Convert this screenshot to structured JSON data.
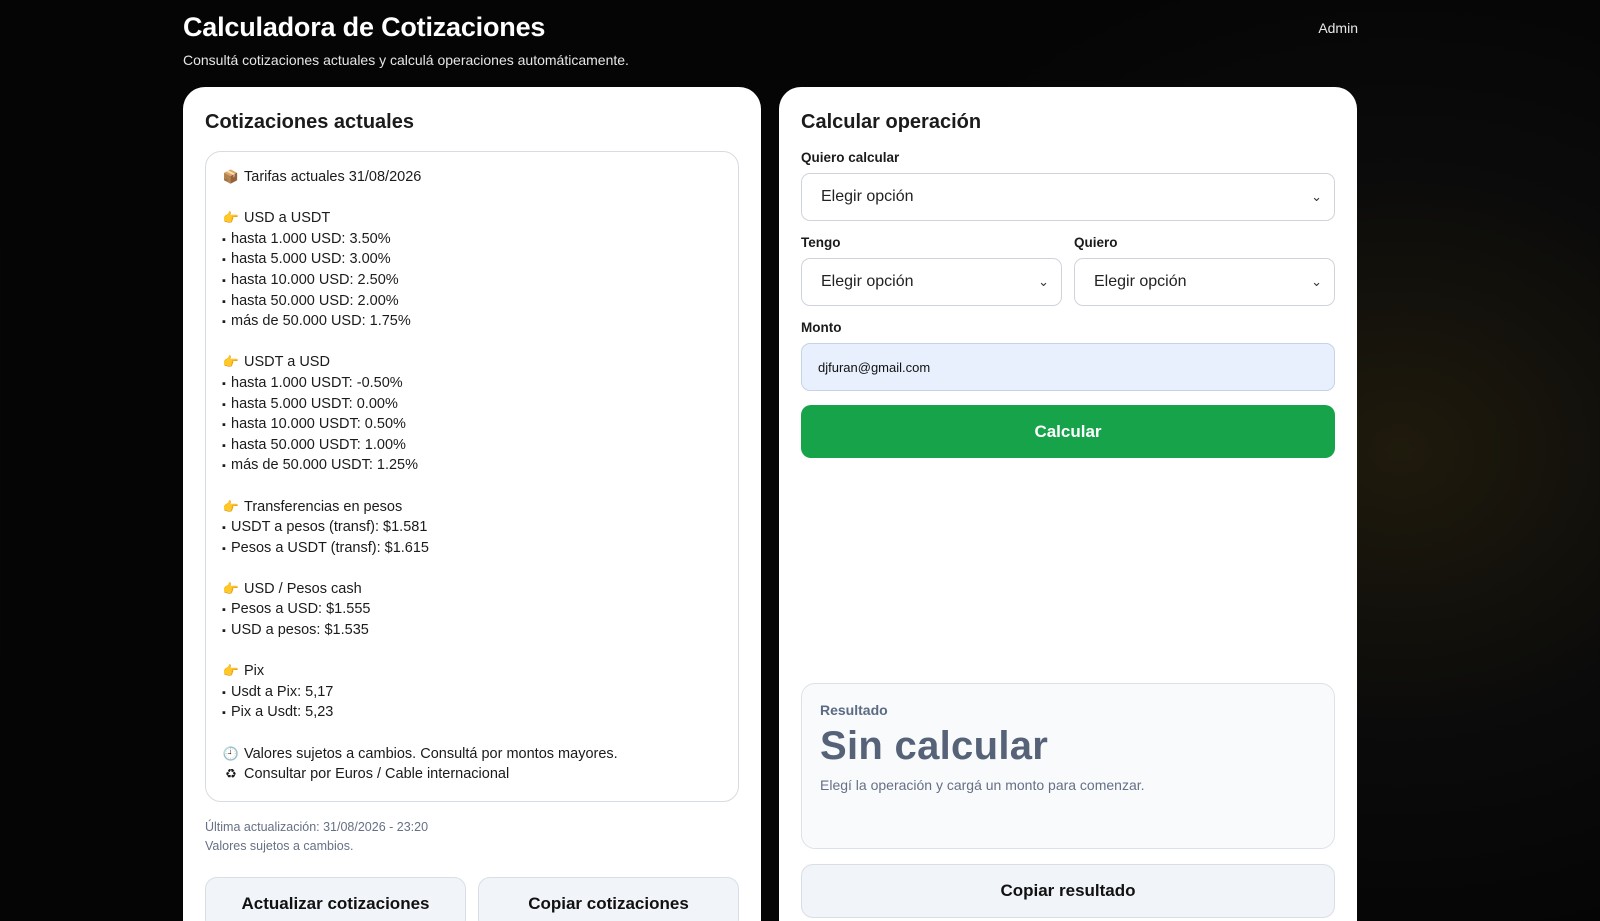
{
  "header": {
    "title": "Calculadora de Cotizaciones",
    "subtitle": "Consultá cotizaciones actuales y calculá operaciones automáticamente.",
    "admin_label": "Admin"
  },
  "rates_card": {
    "title": "Cotizaciones actuales",
    "lines": [
      {
        "kind": "heading",
        "icon": "📦",
        "icon_name": "package-icon",
        "text": "Tarifas actuales 31/08/2026"
      },
      {
        "kind": "heading",
        "icon": "👉",
        "icon_name": "pointing-hand-icon",
        "text": "USD a USDT"
      },
      {
        "kind": "item",
        "text": "hasta 1.000 USD: 3.50%"
      },
      {
        "kind": "item",
        "text": "hasta 5.000 USD: 3.00%"
      },
      {
        "kind": "item",
        "text": "hasta 10.000 USD: 2.50%"
      },
      {
        "kind": "item",
        "text": "hasta 50.000 USD: 2.00%"
      },
      {
        "kind": "item",
        "text": "más de 50.000 USD: 1.75%"
      },
      {
        "kind": "heading",
        "icon": "👉",
        "icon_name": "pointing-hand-icon",
        "text": "USDT a USD"
      },
      {
        "kind": "item",
        "text": "hasta 1.000 USDT: -0.50%"
      },
      {
        "kind": "item",
        "text": "hasta 5.000 USDT: 0.00%"
      },
      {
        "kind": "item",
        "text": "hasta 10.000 USDT: 0.50%"
      },
      {
        "kind": "item",
        "text": "hasta 50.000 USDT: 1.00%"
      },
      {
        "kind": "item",
        "text": "más de 50.000 USDT: 1.25%"
      },
      {
        "kind": "heading",
        "icon": "👉",
        "icon_name": "pointing-hand-icon",
        "text": "Transferencias en pesos"
      },
      {
        "kind": "item",
        "text": "USDT a pesos (transf): $1.581"
      },
      {
        "kind": "item",
        "text": "Pesos a USDT (transf): $1.615"
      },
      {
        "kind": "heading",
        "icon": "👉",
        "icon_name": "pointing-hand-icon",
        "text": "USD / Pesos cash"
      },
      {
        "kind": "item",
        "text": "Pesos a USD: $1.555"
      },
      {
        "kind": "item",
        "text": "USD a pesos: $1.535"
      },
      {
        "kind": "heading",
        "icon": "👉",
        "icon_name": "pointing-hand-icon",
        "text": "Pix"
      },
      {
        "kind": "item",
        "text": "Usdt a Pix: 5,17"
      },
      {
        "kind": "item",
        "text": "Pix a Usdt: 5,23"
      },
      {
        "kind": "heading",
        "icon": "🕘",
        "icon_name": "clock-icon",
        "text": "Valores sujetos a cambios. Consultá por montos mayores."
      },
      {
        "kind": "note",
        "icon": "♻",
        "icon_name": "recycle-icon",
        "text": "Consultar por Euros / Cable internacional"
      }
    ],
    "last_update": "Última actualización: 31/08/2026 - 23:20",
    "disclaimer": "Valores sujetos a cambios.",
    "refresh_button": "Actualizar cotizaciones",
    "copy_button": "Copiar cotizaciones"
  },
  "calc_card": {
    "title": "Calcular operación",
    "want_calc_label": "Quiero calcular",
    "want_calc_value": "Elegir opción",
    "have_label": "Tengo",
    "have_value": "Elegir opción",
    "want_label": "Quiero",
    "want_value": "Elegir opción",
    "amount_label": "Monto",
    "amount_value": "djfuran@gmail.com",
    "calc_button": "Calcular",
    "result_label": "Resultado",
    "result_value": "Sin calcular",
    "result_hint": "Elegí la operación y cargá un monto para comenzar.",
    "copy_result_button": "Copiar resultado"
  },
  "colors": {
    "primary_green": "#16a34a",
    "result_text": "#556277",
    "background": "#0b0b0b"
  }
}
